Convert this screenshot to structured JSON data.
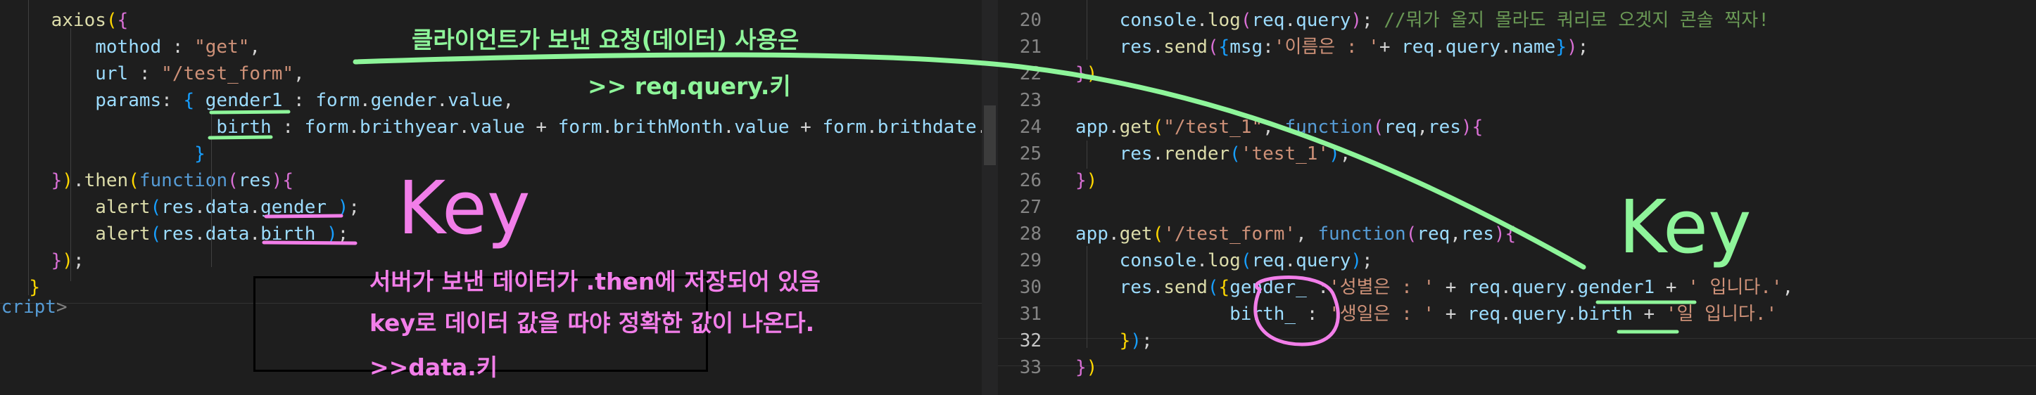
{
  "editor": {
    "left_lines": [
      {
        "tokens": [
          {
            "t": "    "
          },
          {
            "t": "axios",
            "c": "fn"
          },
          {
            "t": "(",
            "c": "b1"
          },
          {
            "t": "{",
            "c": "b2"
          }
        ]
      },
      {
        "tokens": [
          {
            "t": "        "
          },
          {
            "t": "mothod",
            "c": "prop"
          },
          {
            "t": " : "
          },
          {
            "t": "\"get\"",
            "c": "str"
          },
          {
            "t": ","
          }
        ]
      },
      {
        "tokens": [
          {
            "t": "        "
          },
          {
            "t": "url",
            "c": "prop"
          },
          {
            "t": " : "
          },
          {
            "t": "\"/test_form\"",
            "c": "str"
          },
          {
            "t": ","
          }
        ]
      },
      {
        "tokens": [
          {
            "t": "        "
          },
          {
            "t": "params",
            "c": "prop"
          },
          {
            "t": ": "
          },
          {
            "t": "{",
            "c": "b3"
          },
          {
            "t": " "
          },
          {
            "t": "gender1",
            "c": "prop"
          },
          {
            "t": " : "
          },
          {
            "t": "form",
            "c": "var"
          },
          {
            "t": "."
          },
          {
            "t": "gender",
            "c": "prop"
          },
          {
            "t": "."
          },
          {
            "t": "value",
            "c": "prop"
          },
          {
            "t": ","
          }
        ]
      },
      {
        "tokens": [
          {
            "t": "                   "
          },
          {
            "t": "birth",
            "c": "prop"
          },
          {
            "t": " : "
          },
          {
            "t": "form",
            "c": "var"
          },
          {
            "t": "."
          },
          {
            "t": "brithyear",
            "c": "prop"
          },
          {
            "t": "."
          },
          {
            "t": "value",
            "c": "prop"
          },
          {
            "t": " + "
          },
          {
            "t": "form",
            "c": "var"
          },
          {
            "t": "."
          },
          {
            "t": "brithMonth",
            "c": "prop"
          },
          {
            "t": "."
          },
          {
            "t": "value",
            "c": "prop"
          },
          {
            "t": " + "
          },
          {
            "t": "form",
            "c": "var"
          },
          {
            "t": "."
          },
          {
            "t": "brithdate",
            "c": "prop"
          },
          {
            "t": "."
          },
          {
            "t": "va",
            "c": "prop"
          }
        ]
      },
      {
        "tokens": [
          {
            "t": "                 "
          },
          {
            "t": "}",
            "c": "b3"
          }
        ]
      },
      {
        "tokens": [
          {
            "t": "    "
          },
          {
            "t": "}",
            "c": "b2"
          },
          {
            "t": ")",
            "c": "b1"
          },
          {
            "t": "."
          },
          {
            "t": "then",
            "c": "fn"
          },
          {
            "t": "(",
            "c": "b1"
          },
          {
            "t": "function",
            "c": "kw"
          },
          {
            "t": "(",
            "c": "b2"
          },
          {
            "t": "res",
            "c": "var"
          },
          {
            "t": ")",
            "c": "b2"
          },
          {
            "t": "{",
            "c": "b2"
          }
        ]
      },
      {
        "tokens": [
          {
            "t": "        "
          },
          {
            "t": "alert",
            "c": "fn"
          },
          {
            "t": "(",
            "c": "b3"
          },
          {
            "t": "res",
            "c": "var"
          },
          {
            "t": "."
          },
          {
            "t": "data",
            "c": "prop"
          },
          {
            "t": "."
          },
          {
            "t": "gender_",
            "c": "prop"
          },
          {
            "t": ")",
            "c": "b3"
          },
          {
            "t": ";"
          }
        ]
      },
      {
        "tokens": [
          {
            "t": "        "
          },
          {
            "t": "alert",
            "c": "fn"
          },
          {
            "t": "(",
            "c": "b3"
          },
          {
            "t": "res",
            "c": "var"
          },
          {
            "t": "."
          },
          {
            "t": "data",
            "c": "prop"
          },
          {
            "t": "."
          },
          {
            "t": "birth_",
            "c": "prop"
          },
          {
            "t": ")",
            "c": "b3"
          },
          {
            "t": ";"
          }
        ]
      },
      {
        "tokens": [
          {
            "t": "    "
          },
          {
            "t": "}",
            "c": "b2"
          },
          {
            "t": ")",
            "c": "b1"
          },
          {
            "t": ";"
          }
        ]
      },
      {
        "tokens": [
          {
            "t": "  "
          },
          {
            "t": "}",
            "c": "b1"
          }
        ]
      },
      {
        "tokens": [
          {
            "t": "script",
            "c": "kw"
          },
          {
            "t": ">",
            "c": "tag"
          }
        ]
      }
    ],
    "right_lines": [
      {
        "n": "20",
        "tokens": [
          {
            "t": "    "
          },
          {
            "t": "console",
            "c": "var"
          },
          {
            "t": "."
          },
          {
            "t": "log",
            "c": "fn"
          },
          {
            "t": "(",
            "c": "b2"
          },
          {
            "t": "req",
            "c": "var"
          },
          {
            "t": "."
          },
          {
            "t": "query",
            "c": "prop"
          },
          {
            "t": ")",
            "c": "b2"
          },
          {
            "t": "; "
          },
          {
            "t": "//뭐가 올지 몰라도 쿼리로 오겟지 콘솔 찍자!",
            "c": "cmt"
          }
        ]
      },
      {
        "n": "21",
        "tokens": [
          {
            "t": "    "
          },
          {
            "t": "res",
            "c": "var"
          },
          {
            "t": "."
          },
          {
            "t": "send",
            "c": "fn"
          },
          {
            "t": "(",
            "c": "b2"
          },
          {
            "t": "{",
            "c": "b3"
          },
          {
            "t": "msg",
            "c": "prop"
          },
          {
            "t": ":"
          },
          {
            "t": "'이름은 : '",
            "c": "str"
          },
          {
            "t": "+ "
          },
          {
            "t": "req",
            "c": "var"
          },
          {
            "t": "."
          },
          {
            "t": "query",
            "c": "prop"
          },
          {
            "t": "."
          },
          {
            "t": "name",
            "c": "prop"
          },
          {
            "t": "}",
            "c": "b3"
          },
          {
            "t": ")",
            "c": "b2"
          },
          {
            "t": ";"
          }
        ]
      },
      {
        "n": "22",
        "tokens": [
          {
            "t": "}",
            "c": "b2"
          },
          {
            "t": ")",
            "c": "b1"
          }
        ]
      },
      {
        "n": "23",
        "tokens": []
      },
      {
        "n": "24",
        "tokens": [
          {
            "t": "app",
            "c": "var"
          },
          {
            "t": "."
          },
          {
            "t": "get",
            "c": "fn"
          },
          {
            "t": "(",
            "c": "b1"
          },
          {
            "t": "\"/test_1\"",
            "c": "str"
          },
          {
            "t": ", "
          },
          {
            "t": "function",
            "c": "kw"
          },
          {
            "t": "(",
            "c": "b2"
          },
          {
            "t": "req",
            "c": "var"
          },
          {
            "t": ","
          },
          {
            "t": "res",
            "c": "var"
          },
          {
            "t": ")",
            "c": "b2"
          },
          {
            "t": "{",
            "c": "b2"
          }
        ]
      },
      {
        "n": "25",
        "tokens": [
          {
            "t": "    "
          },
          {
            "t": "res",
            "c": "var"
          },
          {
            "t": "."
          },
          {
            "t": "render",
            "c": "fn"
          },
          {
            "t": "(",
            "c": "b3"
          },
          {
            "t": "'test_1'",
            "c": "str"
          },
          {
            "t": ")",
            "c": "b3"
          },
          {
            "t": ";"
          }
        ]
      },
      {
        "n": "26",
        "tokens": [
          {
            "t": "}",
            "c": "b2"
          },
          {
            "t": ")",
            "c": "b1"
          }
        ]
      },
      {
        "n": "27",
        "tokens": []
      },
      {
        "n": "28",
        "tokens": [
          {
            "t": "app",
            "c": "var"
          },
          {
            "t": "."
          },
          {
            "t": "get",
            "c": "fn"
          },
          {
            "t": "(",
            "c": "b1"
          },
          {
            "t": "'/test_form'",
            "c": "str"
          },
          {
            "t": ", "
          },
          {
            "t": "function",
            "c": "kw"
          },
          {
            "t": "(",
            "c": "b2"
          },
          {
            "t": "req",
            "c": "var"
          },
          {
            "t": ","
          },
          {
            "t": "res",
            "c": "var"
          },
          {
            "t": ")",
            "c": "b2"
          },
          {
            "t": "{",
            "c": "b2"
          }
        ]
      },
      {
        "n": "29",
        "tokens": [
          {
            "t": "    "
          },
          {
            "t": "console",
            "c": "var"
          },
          {
            "t": "."
          },
          {
            "t": "log",
            "c": "fn"
          },
          {
            "t": "(",
            "c": "b3"
          },
          {
            "t": "req",
            "c": "var"
          },
          {
            "t": "."
          },
          {
            "t": "query",
            "c": "prop"
          },
          {
            "t": ")",
            "c": "b3"
          },
          {
            "t": ";"
          }
        ]
      },
      {
        "n": "30",
        "tokens": [
          {
            "t": "    "
          },
          {
            "t": "res",
            "c": "var"
          },
          {
            "t": "."
          },
          {
            "t": "send",
            "c": "fn"
          },
          {
            "t": "(",
            "c": "b3"
          },
          {
            "t": "{",
            "c": "b1"
          },
          {
            "t": "gender_",
            "c": "prop"
          },
          {
            "t": " :"
          },
          {
            "t": "'성별은 : '",
            "c": "str"
          },
          {
            "t": " + "
          },
          {
            "t": "req",
            "c": "var"
          },
          {
            "t": "."
          },
          {
            "t": "query",
            "c": "prop"
          },
          {
            "t": "."
          },
          {
            "t": "gender1",
            "c": "prop"
          },
          {
            "t": " + "
          },
          {
            "t": "' 입니다.'",
            "c": "str"
          },
          {
            "t": ","
          }
        ]
      },
      {
        "n": "31",
        "tokens": [
          {
            "t": "              "
          },
          {
            "t": "birth_",
            "c": "prop"
          },
          {
            "t": " : "
          },
          {
            "t": "'생일은 : '",
            "c": "str"
          },
          {
            "t": " + "
          },
          {
            "t": "req",
            "c": "var"
          },
          {
            "t": "."
          },
          {
            "t": "query",
            "c": "prop"
          },
          {
            "t": "."
          },
          {
            "t": "birth",
            "c": "prop"
          },
          {
            "t": " + "
          },
          {
            "t": "'일 입니다.'",
            "c": "str"
          }
        ]
      },
      {
        "n": "32",
        "active": true,
        "tokens": [
          {
            "t": "    "
          },
          {
            "t": "}",
            "c": "b1"
          },
          {
            "t": ")",
            "c": "b3"
          },
          {
            "t": ";"
          }
        ]
      },
      {
        "n": "33",
        "tokens": [
          {
            "t": "}",
            "c": "b2"
          },
          {
            "t": ")",
            "c": "b1"
          }
        ]
      }
    ]
  },
  "annotations": {
    "green_title": "클라이언트가 보낸 요청(데이터) 사용은",
    "green_sub": ">> req.query.키",
    "pink_line1": "서버가 보낸 데이터가 .then에 저장되어 있음",
    "pink_line2": "key로 데이터 값을 따야 정확한 값이 나온다.",
    "pink_line3": ">>data.키",
    "left_key": "Key",
    "right_key": "Key",
    "colors": {
      "green": "#8ef59a",
      "pink": "#f27ee9"
    }
  }
}
